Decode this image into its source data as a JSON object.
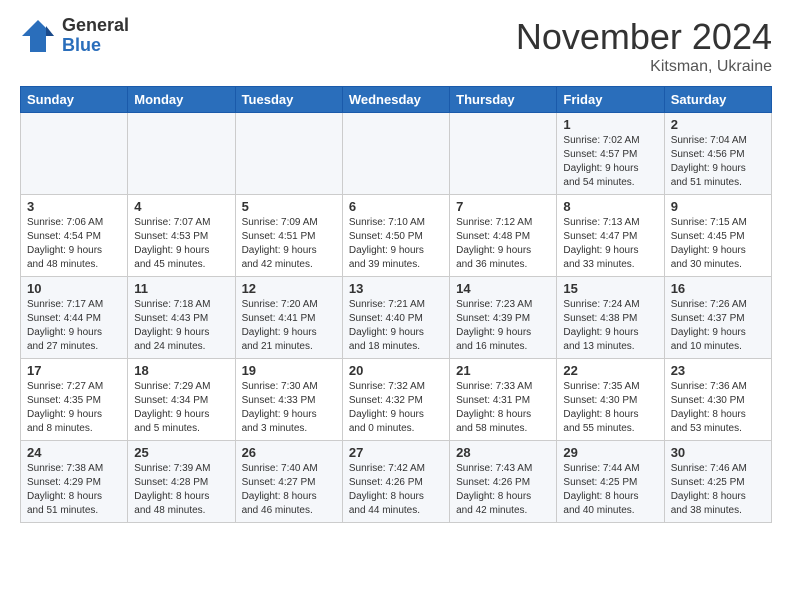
{
  "logo": {
    "general": "General",
    "blue": "Blue"
  },
  "header": {
    "month": "November 2024",
    "location": "Kitsman, Ukraine"
  },
  "weekdays": [
    "Sunday",
    "Monday",
    "Tuesday",
    "Wednesday",
    "Thursday",
    "Friday",
    "Saturday"
  ],
  "weeks": [
    [
      {
        "day": "",
        "info": ""
      },
      {
        "day": "",
        "info": ""
      },
      {
        "day": "",
        "info": ""
      },
      {
        "day": "",
        "info": ""
      },
      {
        "day": "",
        "info": ""
      },
      {
        "day": "1",
        "info": "Sunrise: 7:02 AM\nSunset: 4:57 PM\nDaylight: 9 hours\nand 54 minutes."
      },
      {
        "day": "2",
        "info": "Sunrise: 7:04 AM\nSunset: 4:56 PM\nDaylight: 9 hours\nand 51 minutes."
      }
    ],
    [
      {
        "day": "3",
        "info": "Sunrise: 7:06 AM\nSunset: 4:54 PM\nDaylight: 9 hours\nand 48 minutes."
      },
      {
        "day": "4",
        "info": "Sunrise: 7:07 AM\nSunset: 4:53 PM\nDaylight: 9 hours\nand 45 minutes."
      },
      {
        "day": "5",
        "info": "Sunrise: 7:09 AM\nSunset: 4:51 PM\nDaylight: 9 hours\nand 42 minutes."
      },
      {
        "day": "6",
        "info": "Sunrise: 7:10 AM\nSunset: 4:50 PM\nDaylight: 9 hours\nand 39 minutes."
      },
      {
        "day": "7",
        "info": "Sunrise: 7:12 AM\nSunset: 4:48 PM\nDaylight: 9 hours\nand 36 minutes."
      },
      {
        "day": "8",
        "info": "Sunrise: 7:13 AM\nSunset: 4:47 PM\nDaylight: 9 hours\nand 33 minutes."
      },
      {
        "day": "9",
        "info": "Sunrise: 7:15 AM\nSunset: 4:45 PM\nDaylight: 9 hours\nand 30 minutes."
      }
    ],
    [
      {
        "day": "10",
        "info": "Sunrise: 7:17 AM\nSunset: 4:44 PM\nDaylight: 9 hours\nand 27 minutes."
      },
      {
        "day": "11",
        "info": "Sunrise: 7:18 AM\nSunset: 4:43 PM\nDaylight: 9 hours\nand 24 minutes."
      },
      {
        "day": "12",
        "info": "Sunrise: 7:20 AM\nSunset: 4:41 PM\nDaylight: 9 hours\nand 21 minutes."
      },
      {
        "day": "13",
        "info": "Sunrise: 7:21 AM\nSunset: 4:40 PM\nDaylight: 9 hours\nand 18 minutes."
      },
      {
        "day": "14",
        "info": "Sunrise: 7:23 AM\nSunset: 4:39 PM\nDaylight: 9 hours\nand 16 minutes."
      },
      {
        "day": "15",
        "info": "Sunrise: 7:24 AM\nSunset: 4:38 PM\nDaylight: 9 hours\nand 13 minutes."
      },
      {
        "day": "16",
        "info": "Sunrise: 7:26 AM\nSunset: 4:37 PM\nDaylight: 9 hours\nand 10 minutes."
      }
    ],
    [
      {
        "day": "17",
        "info": "Sunrise: 7:27 AM\nSunset: 4:35 PM\nDaylight: 9 hours\nand 8 minutes."
      },
      {
        "day": "18",
        "info": "Sunrise: 7:29 AM\nSunset: 4:34 PM\nDaylight: 9 hours\nand 5 minutes."
      },
      {
        "day": "19",
        "info": "Sunrise: 7:30 AM\nSunset: 4:33 PM\nDaylight: 9 hours\nand 3 minutes."
      },
      {
        "day": "20",
        "info": "Sunrise: 7:32 AM\nSunset: 4:32 PM\nDaylight: 9 hours\nand 0 minutes."
      },
      {
        "day": "21",
        "info": "Sunrise: 7:33 AM\nSunset: 4:31 PM\nDaylight: 8 hours\nand 58 minutes."
      },
      {
        "day": "22",
        "info": "Sunrise: 7:35 AM\nSunset: 4:30 PM\nDaylight: 8 hours\nand 55 minutes."
      },
      {
        "day": "23",
        "info": "Sunrise: 7:36 AM\nSunset: 4:30 PM\nDaylight: 8 hours\nand 53 minutes."
      }
    ],
    [
      {
        "day": "24",
        "info": "Sunrise: 7:38 AM\nSunset: 4:29 PM\nDaylight: 8 hours\nand 51 minutes."
      },
      {
        "day": "25",
        "info": "Sunrise: 7:39 AM\nSunset: 4:28 PM\nDaylight: 8 hours\nand 48 minutes."
      },
      {
        "day": "26",
        "info": "Sunrise: 7:40 AM\nSunset: 4:27 PM\nDaylight: 8 hours\nand 46 minutes."
      },
      {
        "day": "27",
        "info": "Sunrise: 7:42 AM\nSunset: 4:26 PM\nDaylight: 8 hours\nand 44 minutes."
      },
      {
        "day": "28",
        "info": "Sunrise: 7:43 AM\nSunset: 4:26 PM\nDaylight: 8 hours\nand 42 minutes."
      },
      {
        "day": "29",
        "info": "Sunrise: 7:44 AM\nSunset: 4:25 PM\nDaylight: 8 hours\nand 40 minutes."
      },
      {
        "day": "30",
        "info": "Sunrise: 7:46 AM\nSunset: 4:25 PM\nDaylight: 8 hours\nand 38 minutes."
      }
    ]
  ]
}
